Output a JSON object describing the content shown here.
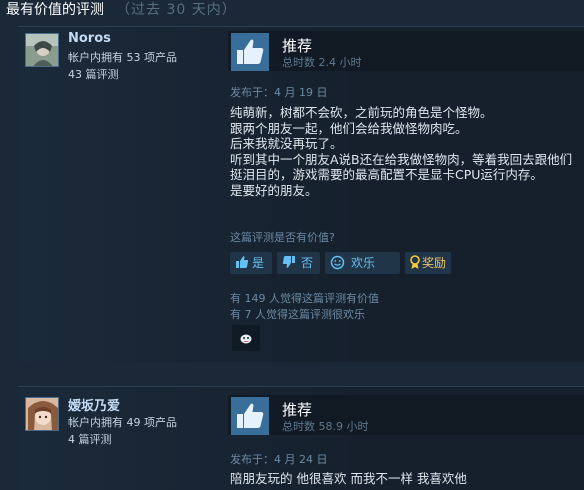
{
  "header": {
    "title": "最有价值的评测",
    "period": "（过去 30 天内）"
  },
  "reviews": [
    {
      "author": "Noros",
      "products": "帐户内拥有 53 项产品",
      "review_count": "43 篇评测",
      "recommendation": "推荐",
      "hours": "总时数 2.4 小时",
      "posted": "发布于：4 月 19 日",
      "body": [
        "纯萌新，树都不会砍，之前玩的角色是个怪物。",
        "跟两个朋友一起，他们会给我做怪物肉吃。",
        "后来我就没再玩了。",
        "听到其中一个朋友A说B还在给我做怪物肉，等着我回去跟他们",
        "挺泪目的，游戏需要的最高配置不是显卡CPU运行内存。",
        "是要好的朋友。"
      ],
      "helpful_question": "这篇评测是否有价值?",
      "buttons": {
        "yes": "是",
        "no": "否",
        "funny": "欢乐",
        "award": "奖励"
      },
      "helpful_stat": "有 149 人觉得这篇评测有价值",
      "funny_stat": "有 7 人觉得这篇评测很欢乐"
    },
    {
      "author": "嫒坂乃爱",
      "products": "帐户内拥有 49 项产品",
      "review_count": "4 篇评测",
      "recommendation": "推荐",
      "hours": "总时数 58.9 小时",
      "posted": "发布于：4 月 24 日",
      "body": [
        "陪朋友玩的 他很喜欢 而我不一样 我喜欢他"
      ]
    }
  ],
  "colors": {
    "background": "#1b2838",
    "accent": "#66c0f4",
    "thumb_bg": "#3a6e9a"
  }
}
